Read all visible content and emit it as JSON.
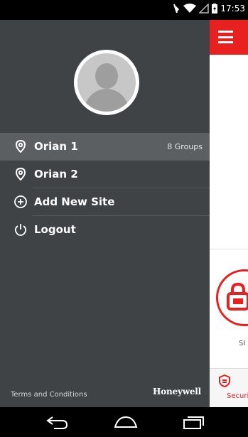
{
  "status_bar": {
    "time": "17:53",
    "icons": [
      "mute-icon",
      "wifi-icon",
      "signal-icon",
      "battery-charging-icon"
    ]
  },
  "drawer": {
    "avatar": "user-avatar-placeholder",
    "sites": [
      {
        "name": "Orian 1",
        "groups": "8 Groups",
        "active": true,
        "icon": "location-pin-icon"
      },
      {
        "name": "Orian 2",
        "groups": "",
        "active": false,
        "icon": "location-pin-icon"
      }
    ],
    "add_site_label": "Add New Site",
    "logout_label": "Logout",
    "terms_label": "Terms and Conditions",
    "brand": "Honeywell"
  },
  "background_app": {
    "card_label_partial": "SI",
    "bottom_tab_label_partial": "Securi",
    "accent_color": "#e8201f"
  },
  "nav_bar": {
    "buttons": [
      "back-icon",
      "home-icon",
      "recents-icon"
    ]
  }
}
